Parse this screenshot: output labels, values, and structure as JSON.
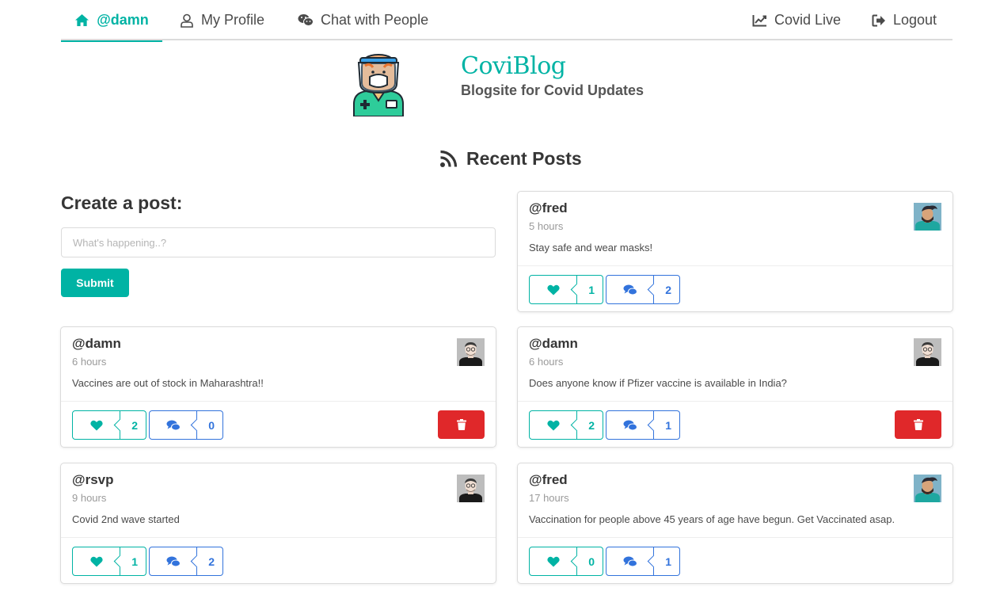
{
  "nav": {
    "home_label": "@damn",
    "profile_label": "My Profile",
    "chat_label": "Chat with People",
    "covid_label": "Covid Live",
    "logout_label": "Logout",
    "accent": "#00b3a4"
  },
  "hero": {
    "title": "CoviBlog",
    "subtitle": "Blogsite for Covid Updates"
  },
  "recent_title": "Recent Posts",
  "create": {
    "title": "Create a post:",
    "placeholder": "What's happening..?",
    "submit_label": "Submit"
  },
  "posts": [
    {
      "user": "@fred",
      "time": "5 hours",
      "text": "Stay safe and wear masks!",
      "likes": "1",
      "comments": "2",
      "avatar": "fred-avatar",
      "deletable": false
    },
    {
      "user": "@damn",
      "time": "6 hours",
      "text": "Vaccines are out of stock in Maharashtra!!",
      "likes": "2",
      "comments": "0",
      "avatar": "damn-avatar",
      "deletable": true
    },
    {
      "user": "@damn",
      "time": "6 hours",
      "text": "Does anyone know if Pfizer vaccine is available in India?",
      "likes": "2",
      "comments": "1",
      "avatar": "damn-avatar",
      "deletable": true
    },
    {
      "user": "@rsvp",
      "time": "9 hours",
      "text": "Covid 2nd wave started",
      "likes": "1",
      "comments": "2",
      "avatar": "rsvp-avatar",
      "deletable": false
    },
    {
      "user": "@fred",
      "time": "17 hours",
      "text": "Vaccination for people above 45 years of age have begun. Get Vaccinated asap.",
      "likes": "0",
      "comments": "1",
      "avatar": "fred-avatar",
      "deletable": false
    }
  ],
  "colors": {
    "primary": "#00b3a4",
    "comment": "#3273dc",
    "danger": "#e0282a"
  }
}
